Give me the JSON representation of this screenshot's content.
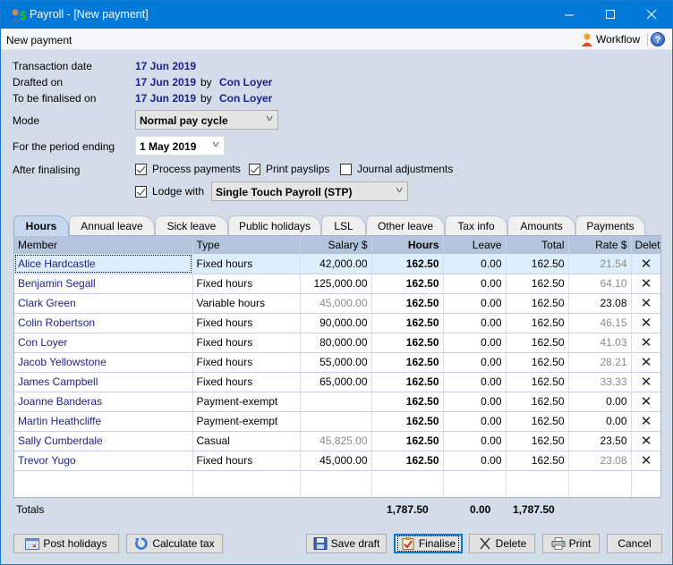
{
  "window": {
    "title": "Payroll - [New payment]",
    "controls": {
      "minimize": "—",
      "maximize": "☐",
      "close": "✕"
    }
  },
  "menubar": {
    "section_title": "New payment",
    "workflow_label": "Workflow",
    "help_label": "?"
  },
  "header": {
    "transaction_date_label": "Transaction date",
    "transaction_date": "17 Jun 2019",
    "drafted_on_label": "Drafted on",
    "drafted_on": "17 Jun 2019",
    "drafted_by_word": "by",
    "drafted_by": "Con Loyer",
    "finalised_on_label": "To be finalised on",
    "finalised_on": "17 Jun 2019",
    "finalised_by_word": "by",
    "finalised_by": "Con Loyer"
  },
  "form": {
    "mode_label": "Mode",
    "mode_value": "Normal pay cycle",
    "period_label": "For the period ending",
    "period_value": "1 May 2019",
    "after_label": "After finalising",
    "process_payments": {
      "label": "Process payments",
      "checked": true
    },
    "print_payslips": {
      "label": "Print payslips",
      "checked": true
    },
    "journal_adjustments": {
      "label": "Journal adjustments",
      "checked": false
    },
    "lodge_with": {
      "label": "Lodge with",
      "checked": true
    },
    "lodge_value": "Single Touch Payroll (STP)"
  },
  "tabs": [
    "Hours",
    "Annual leave",
    "Sick leave",
    "Public holidays",
    "LSL",
    "Other leave",
    "Tax info",
    "Amounts",
    "Payments"
  ],
  "active_tab": "Hours",
  "table": {
    "columns": [
      "Member",
      "Type",
      "Salary $",
      "Hours",
      "Leave",
      "Total",
      "Rate $",
      "Delete"
    ],
    "delete_glyph": "✕",
    "rows": [
      {
        "member": "Alice Hardcastle",
        "type": "Fixed hours",
        "salary": "42,000.00",
        "hours": "162.50",
        "leave": "0.00",
        "total": "162.50",
        "rate": "21.54"
      },
      {
        "member": "Benjamin Segall",
        "type": "Fixed hours",
        "salary": "125,000.00",
        "hours": "162.50",
        "leave": "0.00",
        "total": "162.50",
        "rate": "64.10"
      },
      {
        "member": "Clark Green",
        "type": "Variable hours",
        "salary": "45,000.00",
        "hours": "162.50",
        "leave": "0.00",
        "total": "162.50",
        "rate": "23.08"
      },
      {
        "member": "Colin Robertson",
        "type": "Fixed hours",
        "salary": "90,000.00",
        "hours": "162.50",
        "leave": "0.00",
        "total": "162.50",
        "rate": "46.15"
      },
      {
        "member": "Con Loyer",
        "type": "Fixed hours",
        "salary": "80,000.00",
        "hours": "162.50",
        "leave": "0.00",
        "total": "162.50",
        "rate": "41.03"
      },
      {
        "member": "Jacob Yellowstone",
        "type": "Fixed hours",
        "salary": "55,000.00",
        "hours": "162.50",
        "leave": "0.00",
        "total": "162.50",
        "rate": "28.21"
      },
      {
        "member": "James Campbell",
        "type": "Fixed hours",
        "salary": "65,000.00",
        "hours": "162.50",
        "leave": "0.00",
        "total": "162.50",
        "rate": "33.33"
      },
      {
        "member": "Joanne Banderas",
        "type": "Payment-exempt",
        "salary": "",
        "hours": "162.50",
        "leave": "0.00",
        "total": "162.50",
        "rate": "0.00"
      },
      {
        "member": "Martin Heathcliffe",
        "type": "Payment-exempt",
        "salary": "",
        "hours": "162.50",
        "leave": "0.00",
        "total": "162.50",
        "rate": "0.00"
      },
      {
        "member": "Sally Cumberdale",
        "type": "Casual",
        "salary": "45,825.00",
        "hours": "162.50",
        "leave": "0.00",
        "total": "162.50",
        "rate": "23.50"
      },
      {
        "member": "Trevor Yugo",
        "type": "Fixed hours",
        "salary": "45,000.00",
        "hours": "162.50",
        "leave": "0.00",
        "total": "162.50",
        "rate": "23.08"
      }
    ],
    "grey_salary_rows": [
      2,
      9
    ],
    "grey_rate_rows": [
      0,
      1,
      3,
      4,
      5,
      6,
      10
    ]
  },
  "totals": {
    "label": "Totals",
    "hours": "1,787.50",
    "leave": "0.00",
    "total": "1,787.50"
  },
  "buttons": {
    "post_holidays": "Post holidays",
    "calculate_tax": "Calculate tax",
    "save_draft": "Save draft",
    "finalise": "Finalise",
    "delete": "Delete",
    "print": "Print",
    "cancel": "Cancel"
  }
}
